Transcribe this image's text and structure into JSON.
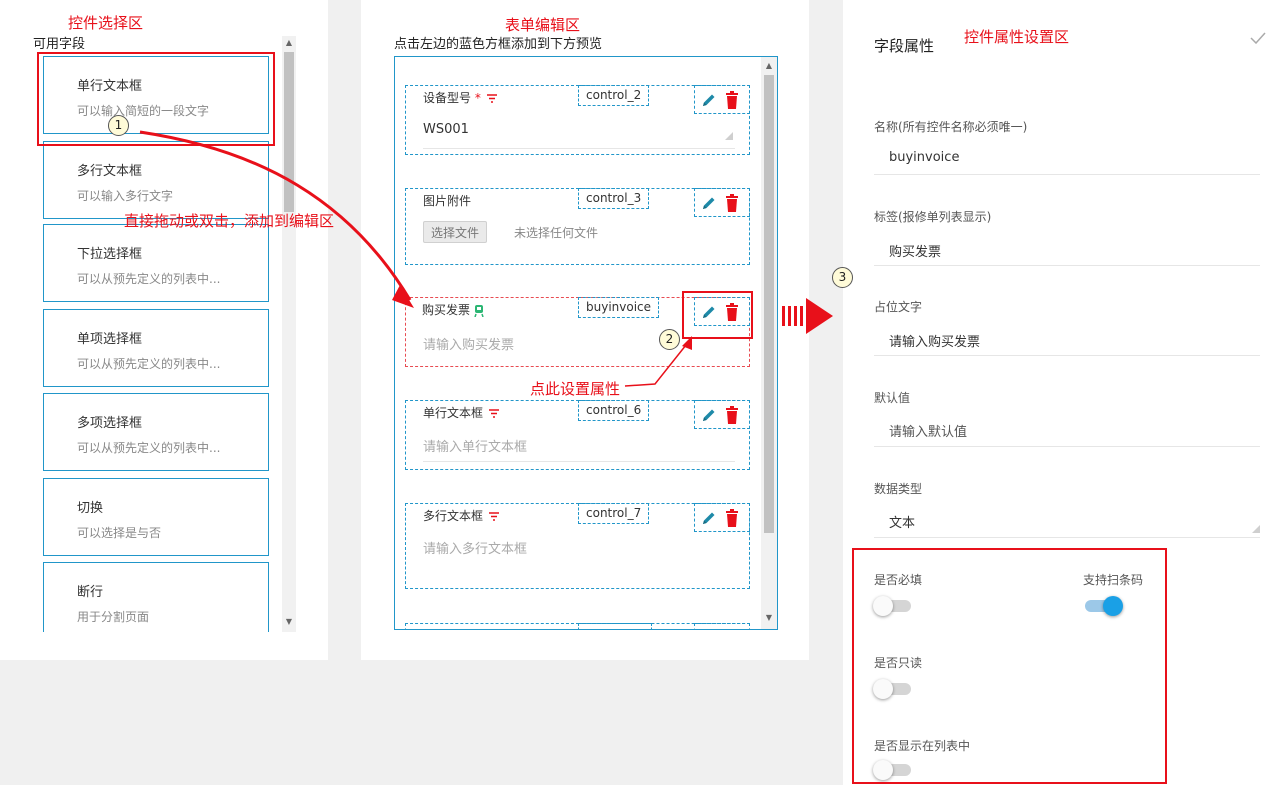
{
  "annotations": {
    "left_zone": "控件选择区",
    "mid_zone": "表单编辑区",
    "right_zone": "控件属性设置区",
    "drag_hint": "直接拖动或双击，添加到编辑区",
    "click_hint": "点此设置属性",
    "step1": "1",
    "step2": "2",
    "step3": "3"
  },
  "left": {
    "title": "可用字段",
    "items": [
      {
        "name": "单行文本框",
        "desc": "可以输入简短的一段文字"
      },
      {
        "name": "多行文本框",
        "desc": "可以输入多行文字"
      },
      {
        "name": "下拉选择框",
        "desc": "可以从预先定义的列表中..."
      },
      {
        "name": "单项选择框",
        "desc": "可以从预先定义的列表中..."
      },
      {
        "name": "多项选择框",
        "desc": "可以从预先定义的列表中..."
      },
      {
        "name": "切换",
        "desc": "可以选择是与否"
      },
      {
        "name": "断行",
        "desc": "用于分割页面"
      }
    ]
  },
  "mid": {
    "title": "点击左边的蓝色方框添加到下方预览",
    "fields": [
      {
        "label": "设备型号",
        "required": "*",
        "id": "control_2",
        "value": "WS001"
      },
      {
        "label": "图片附件",
        "id": "control_3",
        "file_button": "选择文件",
        "file_status": "未选择任何文件"
      },
      {
        "label": "购买发票",
        "id": "buyinvoice",
        "placeholder": "请输入购买发票"
      },
      {
        "label": "单行文本框",
        "id": "control_6",
        "placeholder": "请输入单行文本框"
      },
      {
        "label": "多行文本框",
        "id": "control_7",
        "placeholder": "请输入多行文本框"
      }
    ]
  },
  "right": {
    "title": "字段属性",
    "name_label": "名称(所有控件名称必须唯一)",
    "name_value": "buyinvoice",
    "tag_label": "标签(报修单列表显示)",
    "tag_value": "购买发票",
    "placeholder_label": "占位文字",
    "placeholder_value": "请输入购买发票",
    "default_label": "默认值",
    "default_placeholder": "请输入默认值",
    "datatype_label": "数据类型",
    "datatype_value": "文本",
    "required_label": "是否必填",
    "barcode_label": "支持扫条码",
    "readonly_label": "是否只读",
    "showlist_label": "是否显示在列表中"
  },
  "colors": {
    "accent_blue": "#2196c9",
    "annotation_red": "#e8101a",
    "toggle_on": "#1aa0e6",
    "icon_teal": "#1e8aa8",
    "icon_red": "#e8101a"
  }
}
